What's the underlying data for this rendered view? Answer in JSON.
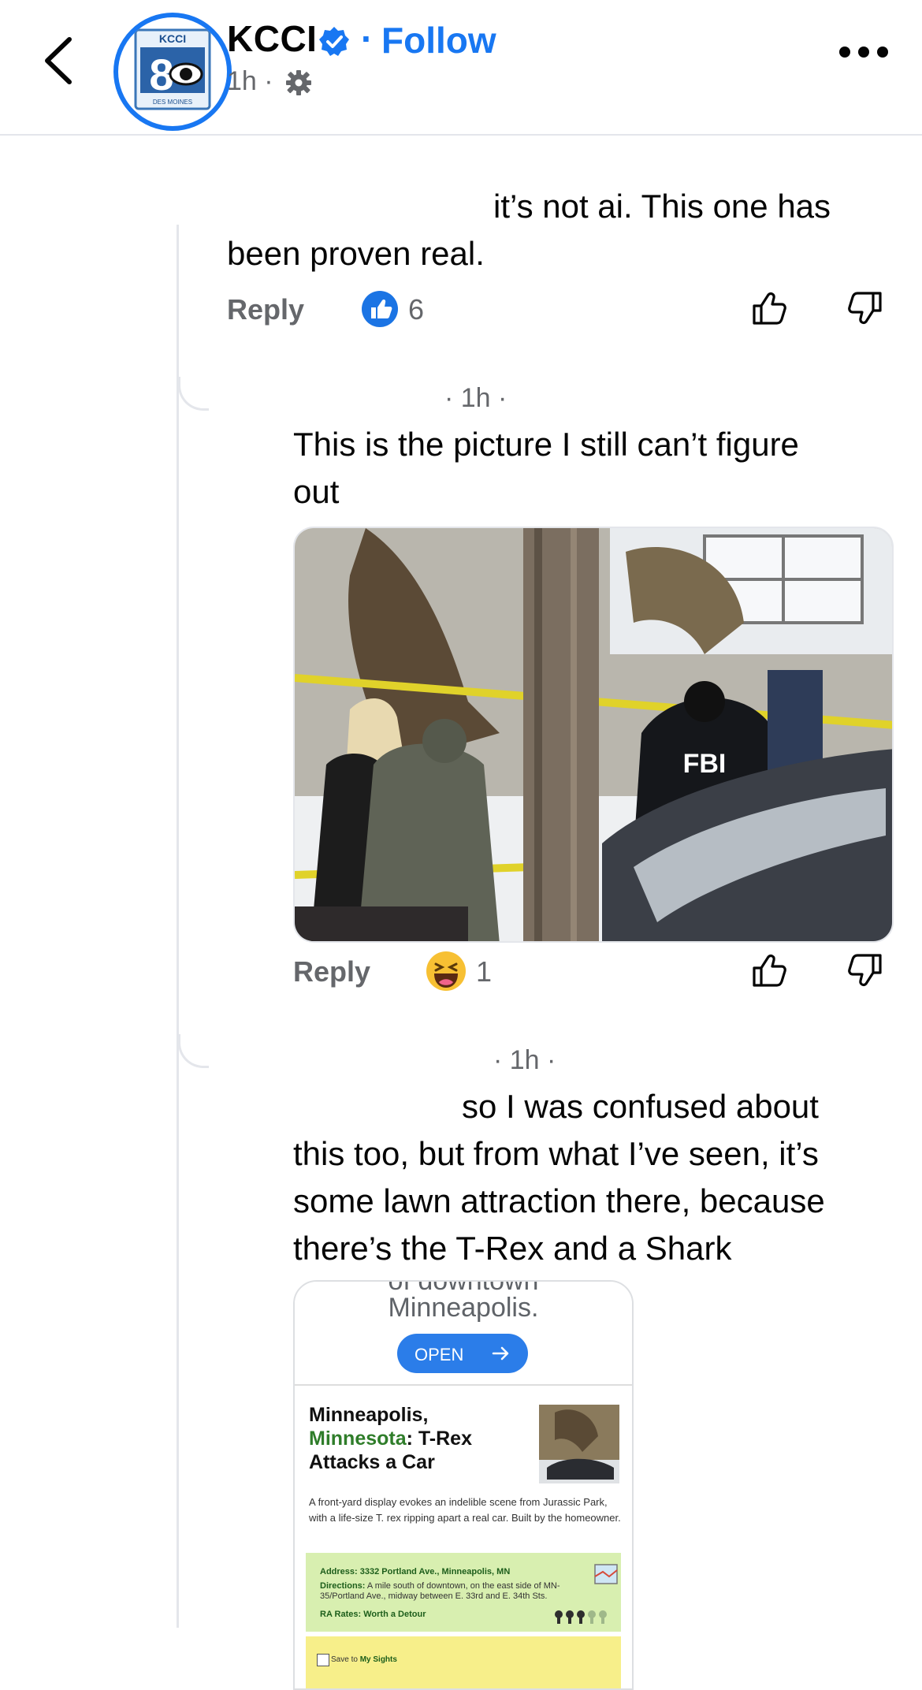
{
  "header": {
    "page_name": "KCCI",
    "follow_label": "Follow",
    "separator": "·",
    "time": "1h ·",
    "logo": {
      "top_text": "KCCI",
      "number": "8",
      "bottom_text": "DES MOINES"
    },
    "icons": [
      "back-chevron-icon",
      "verified-badge-icon",
      "gear-icon",
      "more-icon"
    ],
    "accent_color": "#1877f2"
  },
  "comments": [
    {
      "text_line1": "it’s not ai. This one has",
      "text_line2": "been proven real.",
      "reply_label": "Reply",
      "reaction": {
        "icon": "like-reaction-icon",
        "count": "6"
      }
    },
    {
      "time": "· 1h ·",
      "text_line1": "This is the picture I still can’t figure",
      "text_line2": "out",
      "image": {
        "caption_on_image": "FBI"
      },
      "reply_label": "Reply",
      "reaction": {
        "icon": "haha-reaction-icon",
        "count": "1"
      }
    },
    {
      "time": "· 1h ·",
      "text_line1": "so I was confused about",
      "text_line2": "this too, but from what I’ve seen, it’s",
      "text_line3": "some lawn attraction there, because",
      "text_line4": "there’s the T-Rex and a Shark",
      "card": {
        "partial_top": "of downtown",
        "city": "Minneapolis.",
        "open_label": "OPEN",
        "title_part1": "Minneapolis,",
        "title_green": "Minnesota",
        "title_part2": ": T-Rex Attacks a Car",
        "description": "A front-yard display evokes an indelible scene from Jurassic Park, with a life-size T. rex ripping apart a real car. Built by the homeowner.",
        "address_label": "Address:",
        "address_value": "3332 Portland Ave., Minneapolis, MN",
        "directions_label": "Directions:",
        "directions_value": "A mile south of downtown, on the east side of MN-35/Portland Ave., midway between E. 33rd and E. 34th Sts.",
        "rates_label": "RA Rates:",
        "rates_value": "Worth a Detour",
        "save_label": "Save to",
        "save_link": "My Sights"
      }
    }
  ]
}
